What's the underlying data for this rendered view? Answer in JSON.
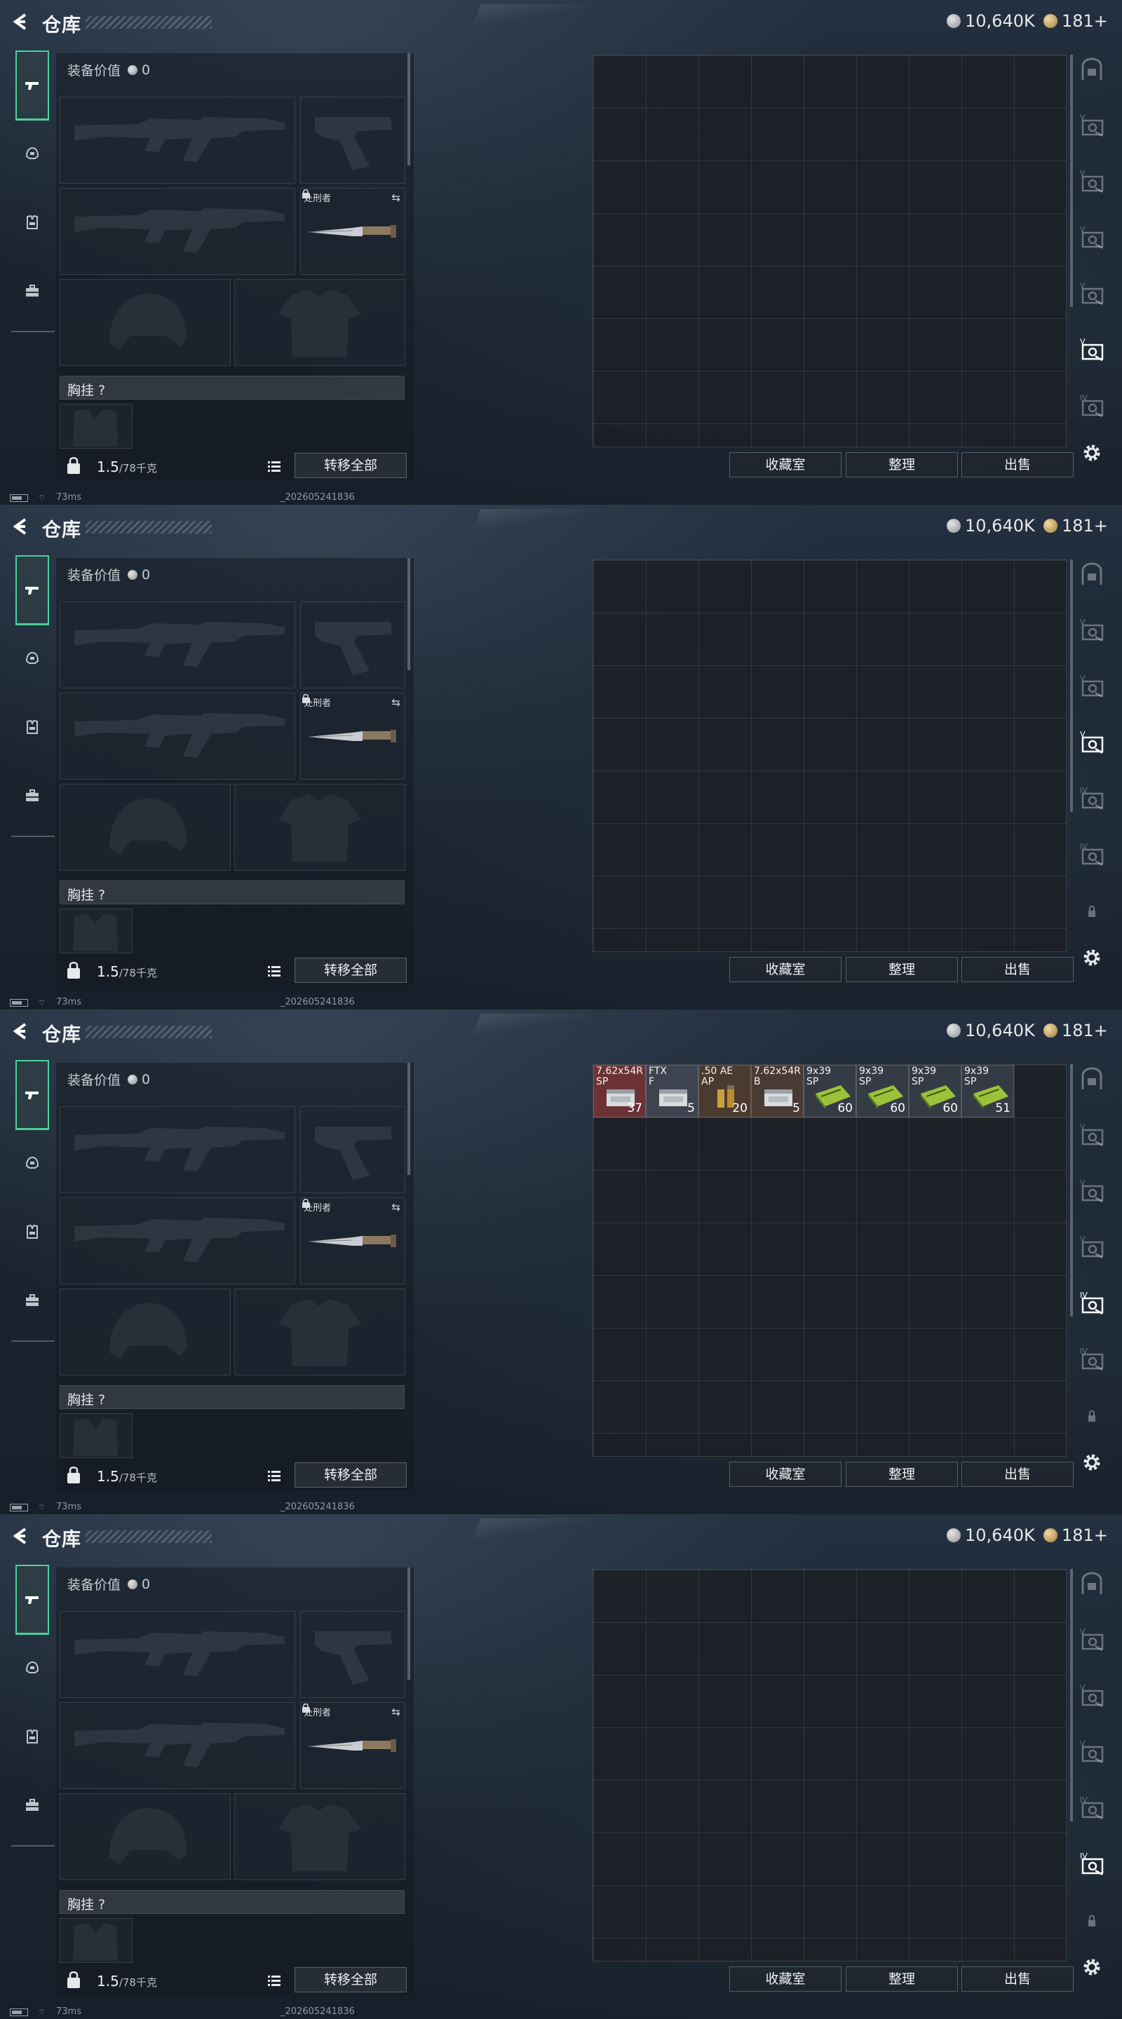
{
  "header": {
    "title": "仓库",
    "currency_silver": "10,640K",
    "currency_gold": "181+"
  },
  "equipment": {
    "value_label": "装备价值",
    "value": "0",
    "melee_name": "处刑者",
    "section_label": "胸挂 ?",
    "weight": "1.5",
    "weight_max": "/78千克",
    "transfer_all": "转移全部"
  },
  "storage_buttons": {
    "collection": "收藏室",
    "sort": "整理",
    "sell": "出售"
  },
  "rail_labels": {
    "tier_v": "V",
    "tier_iv": "IV"
  },
  "frames": [
    {
      "rail": [
        "safe",
        "v",
        "v",
        "v",
        "v",
        "v-active",
        "iv"
      ],
      "items": []
    },
    {
      "rail": [
        "safe",
        "v",
        "v",
        "v-active",
        "iv",
        "iv",
        "lock"
      ],
      "items": []
    },
    {
      "rail": [
        "safe",
        "v",
        "v",
        "v",
        "iv-active",
        "iv",
        "lock"
      ],
      "items": [
        {
          "name": "7.62x54R\nSP",
          "count": "37",
          "kind": "box",
          "bg": "#6b3336"
        },
        {
          "name": "FTX\nF",
          "count": "5",
          "kind": "box",
          "bg": "#3e4450"
        },
        {
          "name": ".50 AE\nAP",
          "count": "20",
          "kind": "round",
          "bg": "#4a3a30"
        },
        {
          "name": "7.62x54R\nB",
          "count": "5",
          "kind": "box",
          "bg": "#4a3a34"
        },
        {
          "name": "9x39\nSP",
          "count": "60",
          "kind": "green",
          "bg": "#353b45"
        },
        {
          "name": "9x39\nSP",
          "count": "60",
          "kind": "green",
          "bg": "#353b45"
        },
        {
          "name": "9x39\nSP",
          "count": "60",
          "kind": "green",
          "bg": "#353b45"
        },
        {
          "name": "9x39\nSP",
          "count": "51",
          "kind": "green",
          "bg": "#353b45"
        }
      ]
    },
    {
      "rail": [
        "safe",
        "v",
        "v",
        "v",
        "iv",
        "iv-active",
        "lock"
      ],
      "items": []
    }
  ],
  "status": {
    "ping": "73ms",
    "build": "_202605241836"
  }
}
